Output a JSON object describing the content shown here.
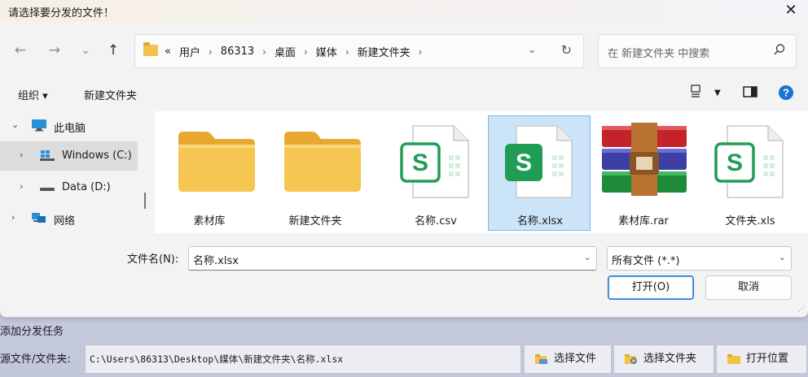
{
  "dialog": {
    "title": "请选择要分发的文件！",
    "close_glyph": "✕",
    "nav": {
      "back": "←",
      "forward": "→",
      "recent": "⌄",
      "up": "↑"
    },
    "address": {
      "overflow": "«",
      "crumbs": [
        "用户",
        "86313",
        "桌面",
        "媒体",
        "新建文件夹"
      ],
      "sep": "›"
    },
    "search_placeholder": "在 新建文件夹 中搜索",
    "toolbar": {
      "organize": "组织 ▾",
      "new_folder": "新建文件夹"
    },
    "sidebar": [
      {
        "label": "此电脑",
        "expanded": true,
        "icon": "monitor-icon"
      },
      {
        "label": "Windows (C:)",
        "selected": true,
        "icon": "windows-drive-icon"
      },
      {
        "label": "Data (D:)",
        "icon": "drive-icon"
      },
      {
        "label": "网络",
        "icon": "network-icon"
      }
    ],
    "files": [
      {
        "name": "素材库",
        "type": "folder"
      },
      {
        "name": "新建文件夹",
        "type": "folder"
      },
      {
        "name": "名称.csv",
        "type": "sheet"
      },
      {
        "name": "名称.xlsx",
        "type": "sheet",
        "selected": true
      },
      {
        "name": "素材库.rar",
        "type": "archive"
      },
      {
        "name": "文件夹.xls",
        "type": "sheet"
      }
    ],
    "filename_label": "文件名(N):",
    "filename_value": "名称.xlsx",
    "filetype_value": "所有文件 (*.*)",
    "open_label": "打开(O)",
    "cancel_label": "取消"
  },
  "app": {
    "task_title": "添加分发任务",
    "source_label": "源文件/文件夹:",
    "source_value": "C:\\Users\\86313\\Desktop\\媒体\\新建文件夹\\名称.xlsx",
    "buttons": [
      "选择文件",
      "选择文件夹",
      "打开位置"
    ]
  },
  "colors": {
    "accent": "#2d7ad6",
    "selection": "#cce4f7",
    "sheet_green": "#1f9d55",
    "folder": "#f3c24a"
  }
}
